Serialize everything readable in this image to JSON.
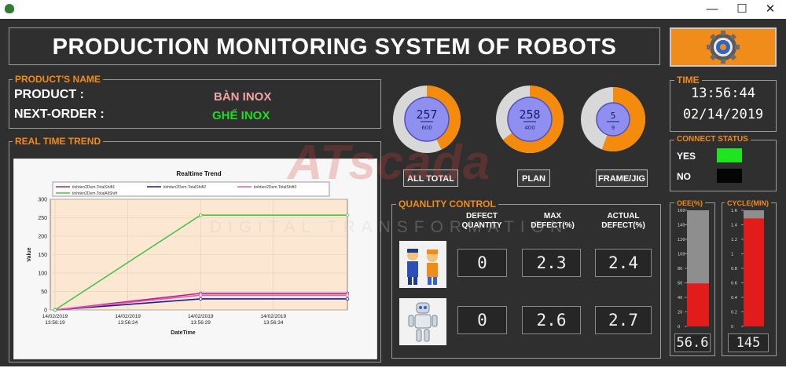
{
  "window": {
    "minimize": "—",
    "maximize": "☐",
    "close": "✕"
  },
  "header": {
    "title": "PRODUCTION MONITORING SYSTEM OF ROBOTS"
  },
  "product": {
    "legend": "PRODUCT'S NAME",
    "product_label": "PRODUCT :",
    "product_value": "BÀN INOX",
    "next_label": "NEXT-ORDER :",
    "next_value": "GHẾ INOX"
  },
  "gauges": [
    {
      "value": "257",
      "max": "600",
      "button": "ALL TOTAL",
      "fraction": 0.428
    },
    {
      "value": "258",
      "max": "400",
      "button": "PLAN",
      "fraction": 0.645
    },
    {
      "value": "5",
      "max": "9",
      "button": "FRAME/JIG",
      "fraction": 0.556
    }
  ],
  "time": {
    "legend": "TIME",
    "clock": "13:56:44",
    "date": "02/14/2019"
  },
  "connect": {
    "legend": "CONNECT STATUS",
    "yes_label": "YES",
    "no_label": "NO",
    "yes_color": "#1ee61e",
    "no_color": "#050505"
  },
  "quality": {
    "legend": "QUANLITY CONTROL",
    "col1": "DEFECT\nQUANTITY",
    "col2": "MAX\nDEFECT(%)",
    "col3": "ACTUAL\nDEFECT(%)",
    "rows": [
      {
        "icon": "workers-icon",
        "defect_qty": "0",
        "max_defect": "2.3",
        "actual_defect": "2.4"
      },
      {
        "icon": "robot-icon",
        "defect_qty": "0",
        "max_defect": "2.6",
        "actual_defect": "2.7"
      }
    ]
  },
  "oee": {
    "legend": "OEE(%)",
    "value": "56.6",
    "level": 0.37,
    "scale": [
      "160",
      "140",
      "120",
      "100",
      "80",
      "60",
      "40",
      "20",
      "0"
    ],
    "color": "#e21b1b"
  },
  "cycle": {
    "legend": "CYCLE(MIN)",
    "value": "145",
    "level": 0.93,
    "scale": [
      "1.6",
      "1.4",
      "1.2",
      "1",
      "0.8",
      "0.6",
      "0.4",
      "0.2",
      "0"
    ],
    "color": "#e21b1b"
  },
  "trend": {
    "legend": "REAL TIME TREND"
  },
  "watermark": {
    "brand": "ATscada",
    "tagline": "DIGITAL TRANSFORMATION"
  },
  "chart_data": {
    "type": "line",
    "title": "Realtime Trend",
    "xlabel": "DateTime",
    "ylabel": "Value",
    "ylim": [
      0,
      300
    ],
    "yticks": [
      "0",
      "50",
      "100",
      "150",
      "200",
      "250",
      "300"
    ],
    "x": [
      "14/02/2019 13:56:19",
      "14/02/2019 13:56:29",
      "14/02/2019 13:56:39"
    ],
    "xticks": [
      {
        "date": "14/02/2019",
        "time": "13:56:19"
      },
      {
        "date": "14/02/2019",
        "time": "13:56:24"
      },
      {
        "date": "14/02/2019",
        "time": "13:56:29"
      },
      {
        "date": "14/02/2019",
        "time": "13:56:34"
      }
    ],
    "series": [
      {
        "name": "tinhtien2Dem.TotalShift1",
        "color": "#b2208e",
        "values": [
          0,
          45,
          45
        ]
      },
      {
        "name": "tinhtien2Dem.TotalShift2",
        "color": "#1b1d8f",
        "values": [
          0,
          30,
          30
        ]
      },
      {
        "name": "tinhtien2Dem.TotalShift3",
        "color": "#ee56b0",
        "values": [
          0,
          40,
          40
        ]
      },
      {
        "name": "tinhtien2Dem.TotalAllShift",
        "color": "#47c447",
        "values": [
          0,
          257,
          257
        ]
      }
    ]
  }
}
